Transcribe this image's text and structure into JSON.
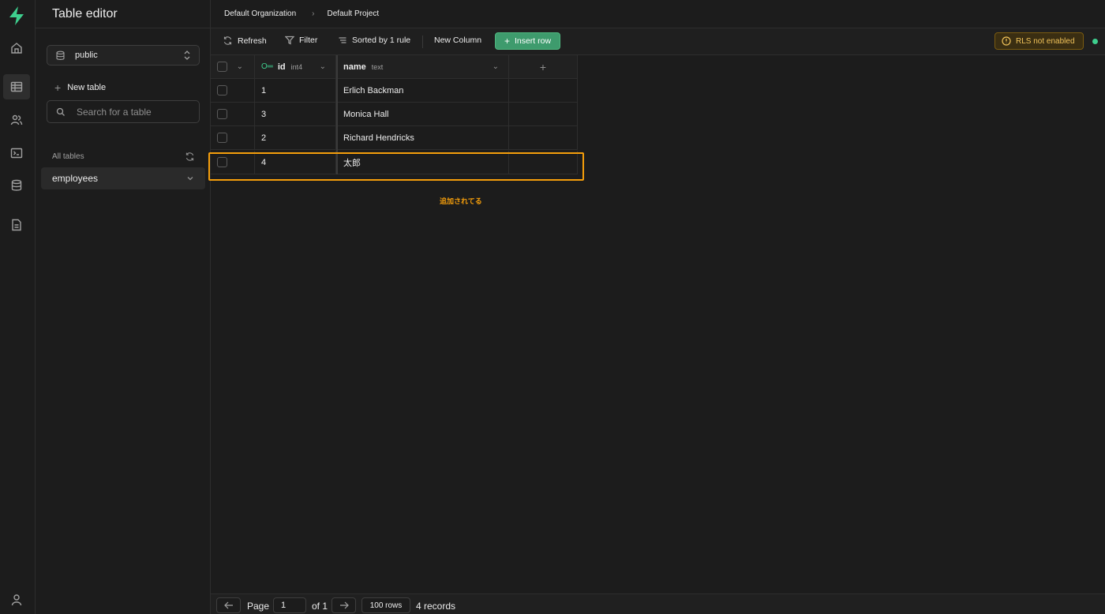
{
  "sidebar": {
    "title": "Table editor",
    "schema": "public",
    "new_table": "New table",
    "search_placeholder": "Search for a table",
    "all_tables": "All tables",
    "tables": [
      {
        "label": "employees"
      }
    ]
  },
  "breadcrumb": {
    "org": "Default Organization",
    "project": "Default Project"
  },
  "toolbar": {
    "refresh": "Refresh",
    "filter": "Filter",
    "sort": "Sorted by 1 rule",
    "new_column": "New Column",
    "insert_row": "Insert row",
    "rls": "RLS not enabled"
  },
  "grid": {
    "columns": [
      {
        "name": "id",
        "type": "int4",
        "primary_key": true
      },
      {
        "name": "name",
        "type": "text"
      }
    ],
    "add_column": "+",
    "rows": [
      {
        "id": "1",
        "name": "Erlich Backman"
      },
      {
        "id": "3",
        "name": "Monica Hall"
      },
      {
        "id": "2",
        "name": "Richard Hendricks"
      },
      {
        "id": "4",
        "name": "太郎"
      }
    ]
  },
  "annotation": "追加されてる",
  "footer": {
    "page_label": "Page",
    "page_value": "1",
    "of_label": "of 1",
    "rows_per_page": "100 rows",
    "records": "4 records"
  },
  "colors": {
    "accent": "#3ecf8e",
    "highlight": "#f59e0b",
    "warning": "#f1c35a"
  }
}
